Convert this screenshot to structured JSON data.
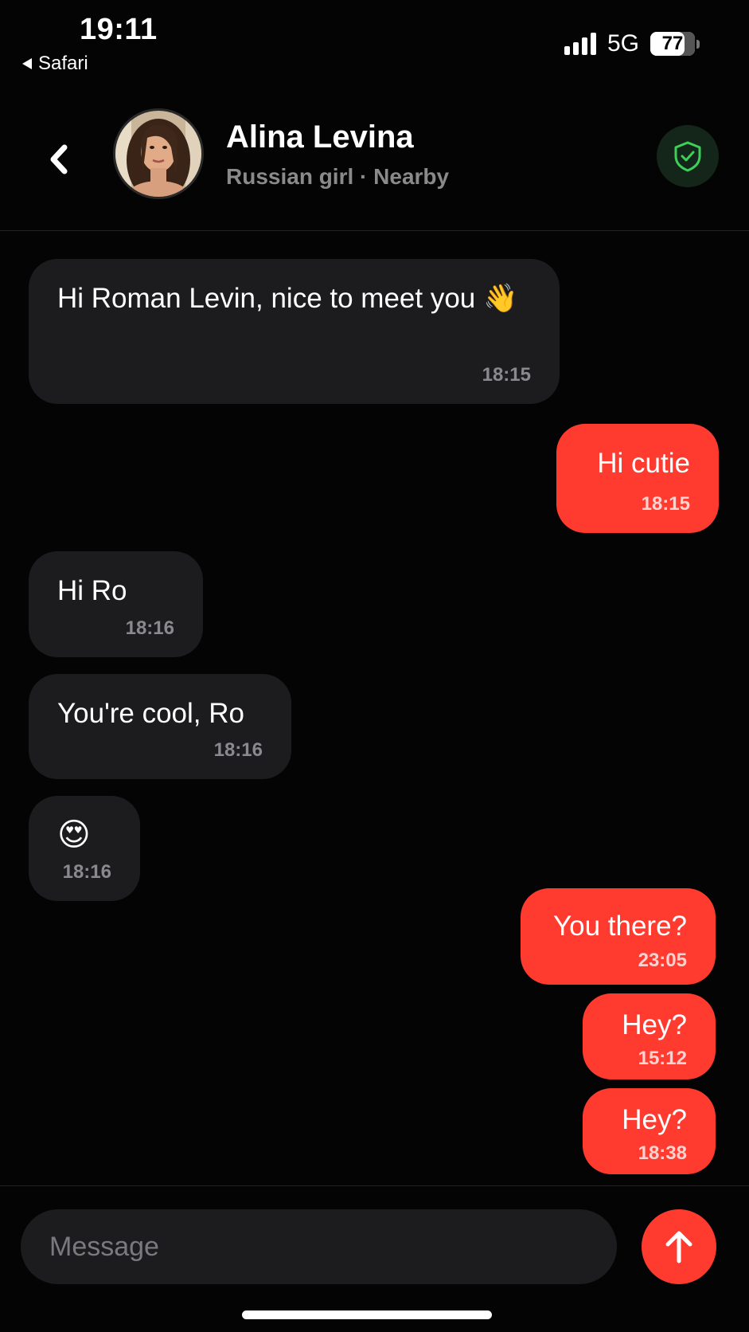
{
  "status_bar": {
    "time": "19:11",
    "back_app": "Safari",
    "network": "5G",
    "battery": "77",
    "battery_level_percent": 77
  },
  "header": {
    "name": "Alina Levina",
    "subtitle": "Russian girl · Nearby",
    "back_icon": "chevron-left-icon",
    "verified_icon": "shield-check-icon",
    "accent_green": "#3ecf5a"
  },
  "messages": [
    {
      "direction": "incoming",
      "text": "Hi Roman Levin, nice to meet you 👋",
      "time": "18:15"
    },
    {
      "direction": "outgoing",
      "text": "Hi cutie",
      "time": "18:15"
    },
    {
      "direction": "incoming",
      "text": "Hi Ro",
      "time": "18:16"
    },
    {
      "direction": "incoming",
      "text": "You're cool, Ro",
      "time": "18:16"
    },
    {
      "direction": "incoming",
      "text": "😍",
      "time": "18:16"
    },
    {
      "direction": "outgoing",
      "text": "You there?",
      "time": "23:05"
    },
    {
      "direction": "outgoing",
      "text": "Hey?",
      "time": "15:12"
    },
    {
      "direction": "outgoing",
      "text": "Hey?",
      "time": "18:38"
    }
  ],
  "composer": {
    "placeholder": "Message",
    "send_icon": "arrow-up-icon"
  },
  "colors": {
    "outgoing_bubble": "#ff3b30",
    "incoming_bubble": "#1c1c1e",
    "background": "#040404"
  }
}
